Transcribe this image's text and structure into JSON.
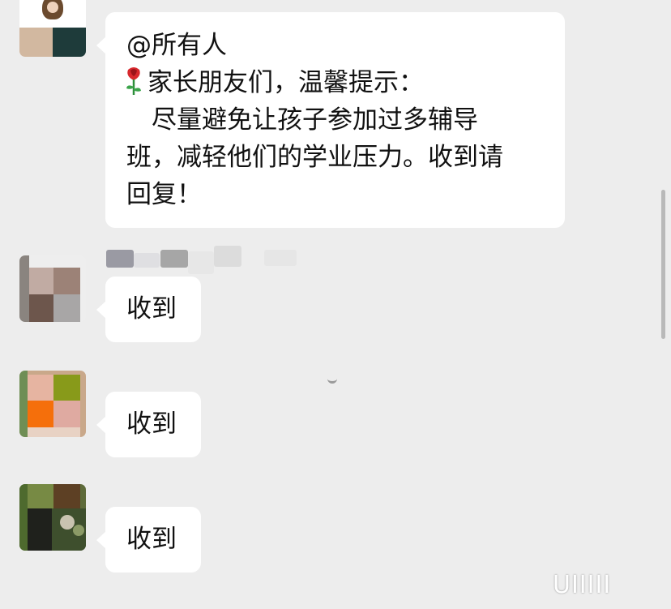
{
  "messages": {
    "main": {
      "lines": [
        "@所有人",
        "家长朋友们，温馨提示：",
        "　尽量避免让孩子参加过多辅导",
        "班，减轻他们的学业压力。收到请",
        "回复！"
      ],
      "rose_icon": "rose-emoji"
    },
    "replies": [
      "收到",
      "收到",
      "收到"
    ]
  },
  "watermark": "UIIIII",
  "colors": {
    "background": "#ededed",
    "bubble": "#ffffff",
    "text": "#111111",
    "scrollbar": "#b9b9b9"
  }
}
